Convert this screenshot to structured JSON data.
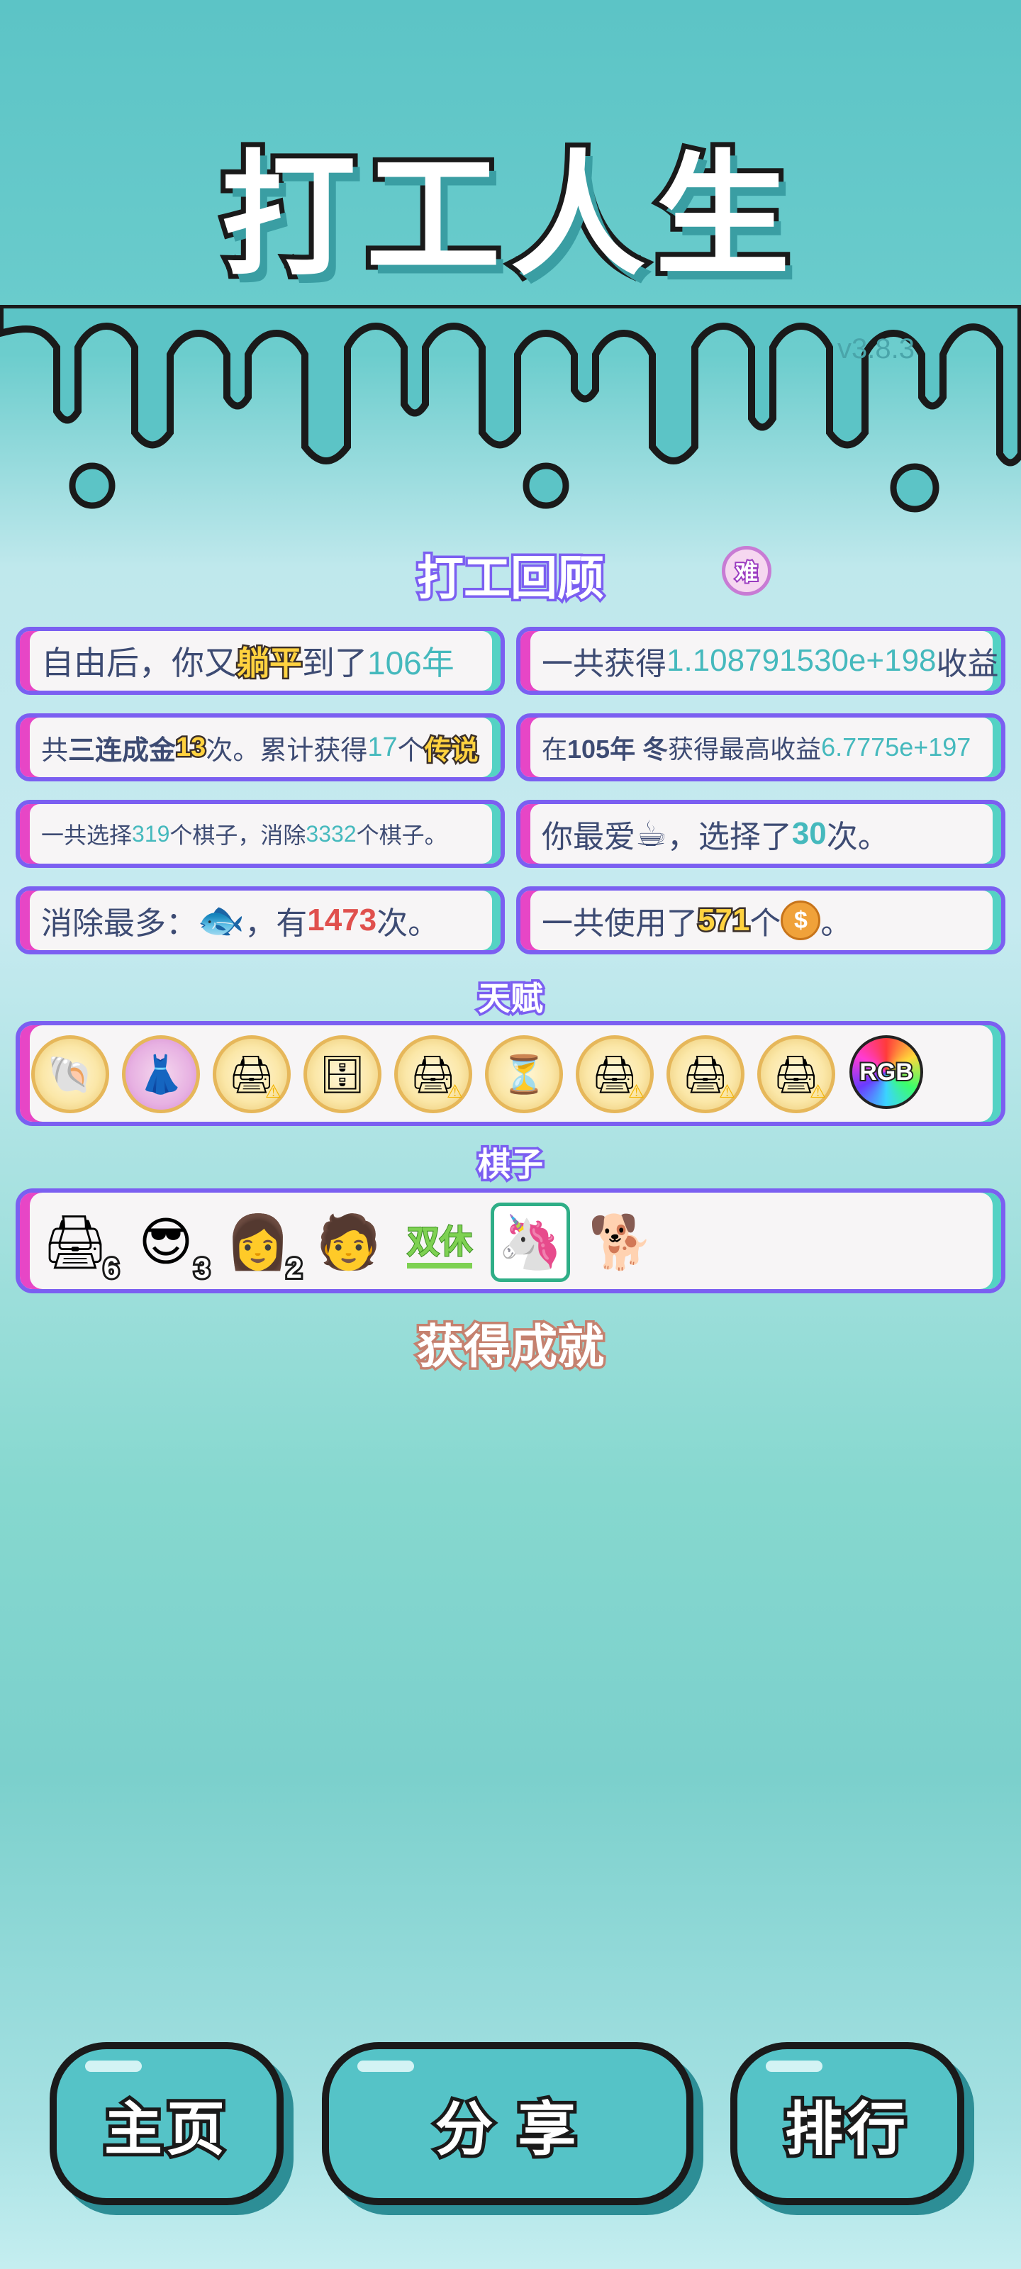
{
  "header": {
    "title": "打工人生",
    "version": "v3.8.3"
  },
  "review": {
    "title": "打工回顾",
    "difficulty_badge": "难",
    "stats": [
      {
        "parts": [
          "自由后，你又",
          "躺平",
          "到了",
          "106年"
        ]
      },
      {
        "parts": [
          "一共获得",
          "1.108791530e+198",
          "收益"
        ]
      },
      {
        "parts": [
          "共",
          "三连成金",
          "13",
          "次。累计获得",
          "17",
          "个",
          "传说"
        ]
      },
      {
        "parts": [
          "在 ",
          "105年 冬",
          " 获得最高收益",
          "6.7775e+197"
        ]
      },
      {
        "parts": [
          "一共选择",
          "319",
          "个棋子，消除",
          "3332",
          "个棋子。"
        ]
      },
      {
        "parts": [
          "你最爱",
          "，选择了",
          "30",
          "次。"
        ]
      },
      {
        "parts": [
          "消除最多：",
          "，有",
          "1473",
          "次。"
        ]
      },
      {
        "parts": [
          "一共使用了",
          "571",
          "个",
          "。"
        ]
      }
    ]
  },
  "talents": {
    "title": "天赋",
    "items": [
      {
        "icon": "shell-icon",
        "glyph": "🐚"
      },
      {
        "icon": "skirt-icon",
        "glyph": "👗"
      },
      {
        "icon": "printer-icon",
        "glyph": "🖨",
        "warning": "⚠"
      },
      {
        "icon": "safe-icon",
        "glyph": "🗄"
      },
      {
        "icon": "printer-icon",
        "glyph": "🖨",
        "warning": "⚠"
      },
      {
        "icon": "hourglass-icon",
        "glyph": "⏳"
      },
      {
        "icon": "printer-icon",
        "glyph": "🖨",
        "warning": "⚠"
      },
      {
        "icon": "printer-icon",
        "glyph": "🖨",
        "warning": "⚠"
      },
      {
        "icon": "printer-icon",
        "glyph": "🖨",
        "warning": "⚠"
      },
      {
        "icon": "rgb-icon",
        "label": "RGB"
      }
    ]
  },
  "pieces": {
    "title": "棋子",
    "items": [
      {
        "icon": "printer-icon",
        "glyph": "🖨",
        "count": "6"
      },
      {
        "icon": "man-sunglasses-icon",
        "glyph": "😎",
        "count": "3"
      },
      {
        "icon": "woman-icon",
        "glyph": "👩",
        "count": "2"
      },
      {
        "icon": "man-bucket-hat-icon",
        "glyph": "🧑"
      },
      {
        "icon": "double-rest-icon",
        "label": "双休"
      },
      {
        "icon": "unicorn-icon",
        "glyph": "🦄"
      },
      {
        "icon": "husky-icon",
        "glyph": "🐕"
      }
    ]
  },
  "achievements": {
    "title": "获得成就"
  },
  "buttons": {
    "home": "主页",
    "share": "分 享",
    "rank": "排行"
  },
  "colors": {
    "accent": "#7b5ff1",
    "pink": "#e746c6",
    "teal": "#54d2c4",
    "button": "#55c3c7"
  }
}
